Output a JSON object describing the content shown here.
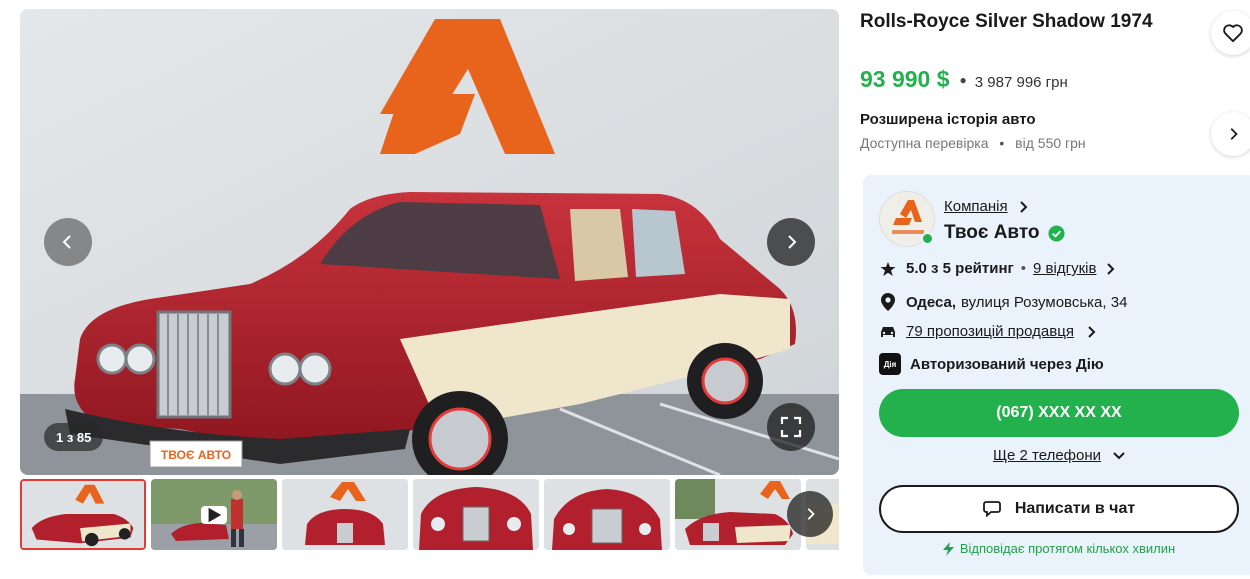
{
  "gallery": {
    "counter": "1 з 85",
    "plate_text": "ТВОЄ АВТО",
    "icons": {
      "prev": "chevron-left-icon",
      "next": "chevron-right-icon",
      "fullscreen": "fullscreen-icon"
    }
  },
  "thumbnails": {
    "count_visible": 7,
    "video_thumb_index": 1
  },
  "listing": {
    "title": "Rolls-Royce Silver Shadow 1974",
    "price_usd": "93 990 $",
    "price_uah": "3 987 996 грн",
    "history_title": "Розширена історія авто",
    "history_available": "Доступна перевірка",
    "history_price": "від 550 грн"
  },
  "seller": {
    "company_label": "Компанія",
    "name": "Твоє Авто",
    "rating": "5.0 з 5 рейтинг",
    "reviews": "9 відгуків",
    "city": "Одеса,",
    "address": "вулиця Розумовська, 34",
    "offers": "79 пропозицій продавця",
    "diia_badge": "Дія",
    "authorized": "Авторизований через Дію",
    "phone": "(067) XXX XX XX",
    "more_phones": "Ще 2 телефони",
    "chat": "Написати в чат",
    "response": "Відповідає протягом кількох хвилин"
  },
  "colors": {
    "accent_green": "#22b14c",
    "panel_bg": "#eaf3fb",
    "logo_orange": "#e8641c",
    "car_red": "#b2202e",
    "car_cream": "#efe6cc"
  }
}
